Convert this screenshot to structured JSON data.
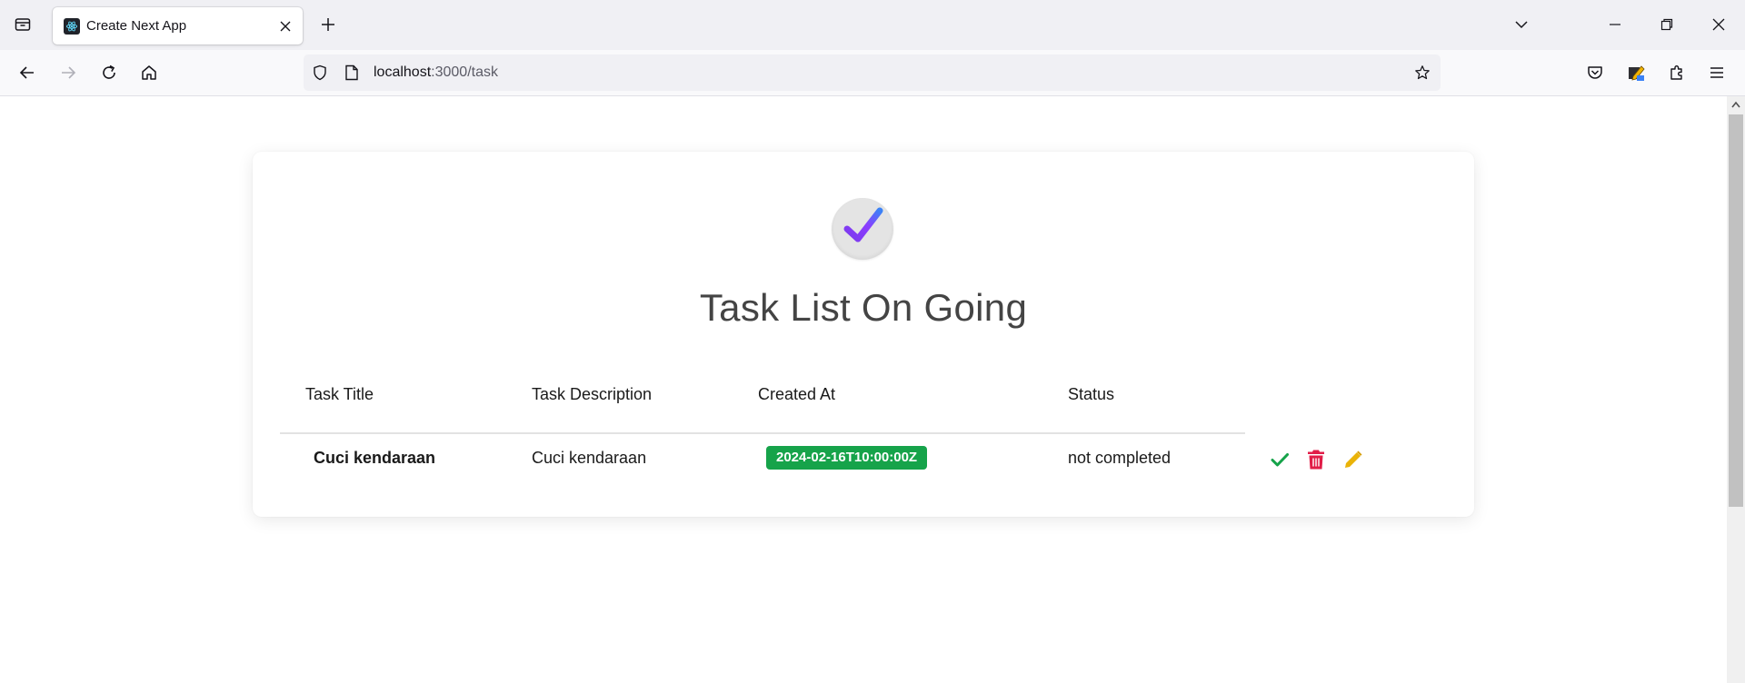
{
  "browser": {
    "tab": {
      "title": "Create Next App"
    },
    "url": {
      "host": "localhost",
      "path": ":3000/task"
    }
  },
  "page": {
    "title": "Task List On Going",
    "table": {
      "headers": [
        "Task Title",
        "Task Description",
        "Created At",
        "Status"
      ],
      "rows": [
        {
          "title": "Cuci kendaraan",
          "description": "Cuci kendaraan",
          "created_at": "2024-02-16T10:00:00Z",
          "status": "not completed"
        }
      ]
    },
    "actions": {
      "complete_icon": "check-icon",
      "delete_icon": "trash-icon",
      "edit_icon": "pencil-icon"
    }
  },
  "colors": {
    "badge": "#16a34a",
    "complete": "#16a34a",
    "delete": "#e11d48",
    "edit": "#eab308",
    "logo_check_start": "#7c3aed",
    "logo_check_end": "#3b82f6"
  }
}
